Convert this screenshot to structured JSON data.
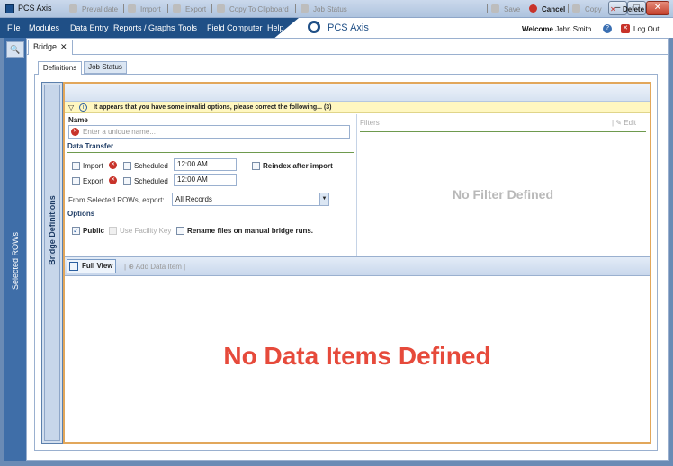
{
  "window": {
    "title": "PCS Axis",
    "min": "–",
    "max": "□",
    "close": "✕"
  },
  "menu": [
    "File",
    "Modules",
    "Data Entry",
    "Reports / Graphs",
    "Tools",
    "Field Computer",
    "Help"
  ],
  "brand": {
    "name": "PCS Axis",
    "icon": "axis-logo-icon"
  },
  "user": {
    "welcome": "Welcome",
    "name": "John Smith",
    "logout": "Log Out"
  },
  "rail": {
    "label": "Selected ROWs",
    "dots": "....",
    "search_icon": "🔍"
  },
  "doc_tab": {
    "label": "Bridge",
    "close": "✕"
  },
  "subtabs": [
    "Definitions",
    "Job Status"
  ],
  "strip_label": "Bridge Definitions",
  "toolbar": {
    "prevalidate": "Prevalidate",
    "import": "Import",
    "export": "Export",
    "copy_clipboard": "Copy To Clipboard",
    "job_status": "Job Status",
    "save": "Save",
    "cancel": "Cancel",
    "copy": "Copy",
    "delete": "Delete"
  },
  "warning": {
    "text": "It appears that you have some invalid options, please correct the following...  (3)"
  },
  "name": {
    "label": "Name",
    "placeholder": "Enter a unique name..."
  },
  "data_transfer": {
    "label": "Data Transfer",
    "import": "Import",
    "export": "Export",
    "scheduled": "Scheduled",
    "import_time": "12:00 AM",
    "export_time": "12:00 AM",
    "reindex": "Reindex after import",
    "from_label": "From Selected ROWs, export:",
    "from_value": "All Records"
  },
  "options": {
    "label": "Options",
    "public": "Public",
    "use_facility_key": "Use Facility Key",
    "rename": "Rename files on manual bridge runs."
  },
  "filters": {
    "label": "Filters",
    "edit": "Edit",
    "empty": "No Filter Defined"
  },
  "items": {
    "full_view": "Full View",
    "add": "Add Data Item",
    "empty": "No Data Items Defined"
  },
  "colors": {
    "accent": "#1f4f86",
    "frame": "#e2a75b",
    "error": "#c8332a",
    "empty_items": "#e64a3b"
  }
}
